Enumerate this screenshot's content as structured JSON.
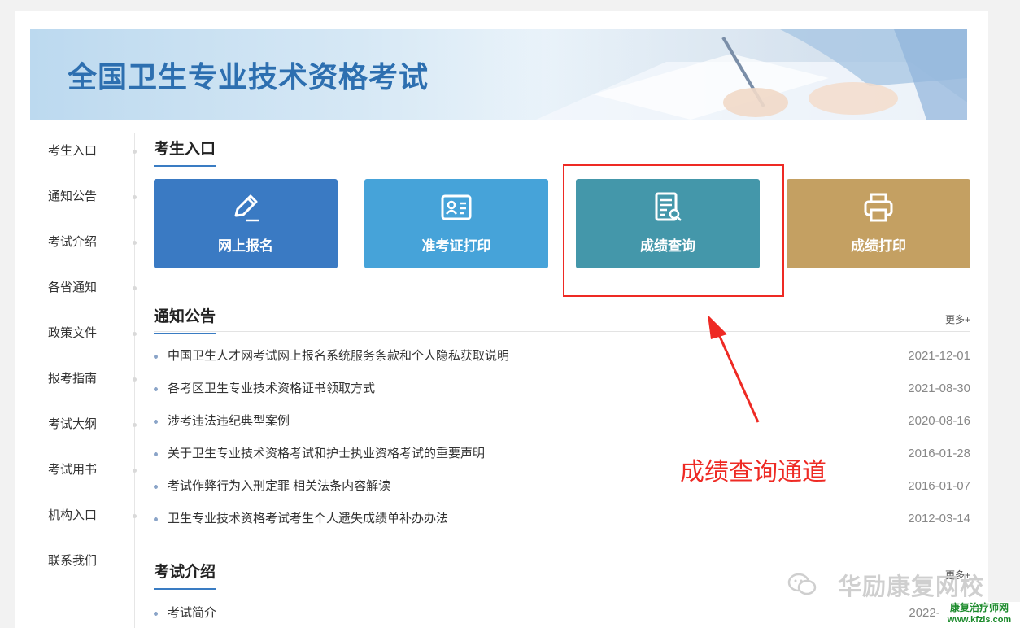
{
  "banner": {
    "title": "全国卫生专业技术资格考试"
  },
  "sidebar": {
    "items": [
      {
        "label": "考生入口"
      },
      {
        "label": "通知公告"
      },
      {
        "label": "考试介绍"
      },
      {
        "label": "各省通知"
      },
      {
        "label": "政策文件"
      },
      {
        "label": "报考指南"
      },
      {
        "label": "考试大纲"
      },
      {
        "label": "考试用书"
      },
      {
        "label": "机构入口"
      },
      {
        "label": "联系我们"
      }
    ]
  },
  "entry": {
    "title": "考生入口",
    "tiles": [
      {
        "label": "网上报名",
        "icon": "pencil-icon",
        "color": "#3a7ac3"
      },
      {
        "label": "准考证打印",
        "icon": "id-card-icon",
        "color": "#46a3d9"
      },
      {
        "label": "成绩查询",
        "icon": "document-search-icon",
        "color": "#4497aa"
      },
      {
        "label": "成绩打印",
        "icon": "printer-icon",
        "color": "#c4a062"
      }
    ]
  },
  "notices": {
    "title": "通知公告",
    "more": "更多+",
    "items": [
      {
        "title": "中国卫生人才网考试网上报名系统服务条款和个人隐私获取说明",
        "date": "2021-12-01"
      },
      {
        "title": "各考区卫生专业技术资格证书领取方式",
        "date": "2021-08-30"
      },
      {
        "title": "涉考违法违纪典型案例",
        "date": "2020-08-16"
      },
      {
        "title": "关于卫生专业技术资格考试和护士执业资格考试的重要声明",
        "date": "2016-01-28"
      },
      {
        "title": "考试作弊行为入刑定罪 相关法条内容解读",
        "date": "2016-01-07"
      },
      {
        "title": "卫生专业技术资格考试考生个人遗失成绩单补办办法",
        "date": "2012-03-14"
      }
    ]
  },
  "intro": {
    "title": "考试介绍",
    "more": "更多+",
    "items": [
      {
        "title": "考试简介",
        "date": "2022-11-10"
      }
    ]
  },
  "annotation": {
    "text": "成绩查询通道",
    "color": "#ee2a24"
  },
  "watermark": {
    "text": "华励康复网校",
    "badge_top": "康复治疗师网",
    "badge_bottom": "www.kfzls.com"
  }
}
